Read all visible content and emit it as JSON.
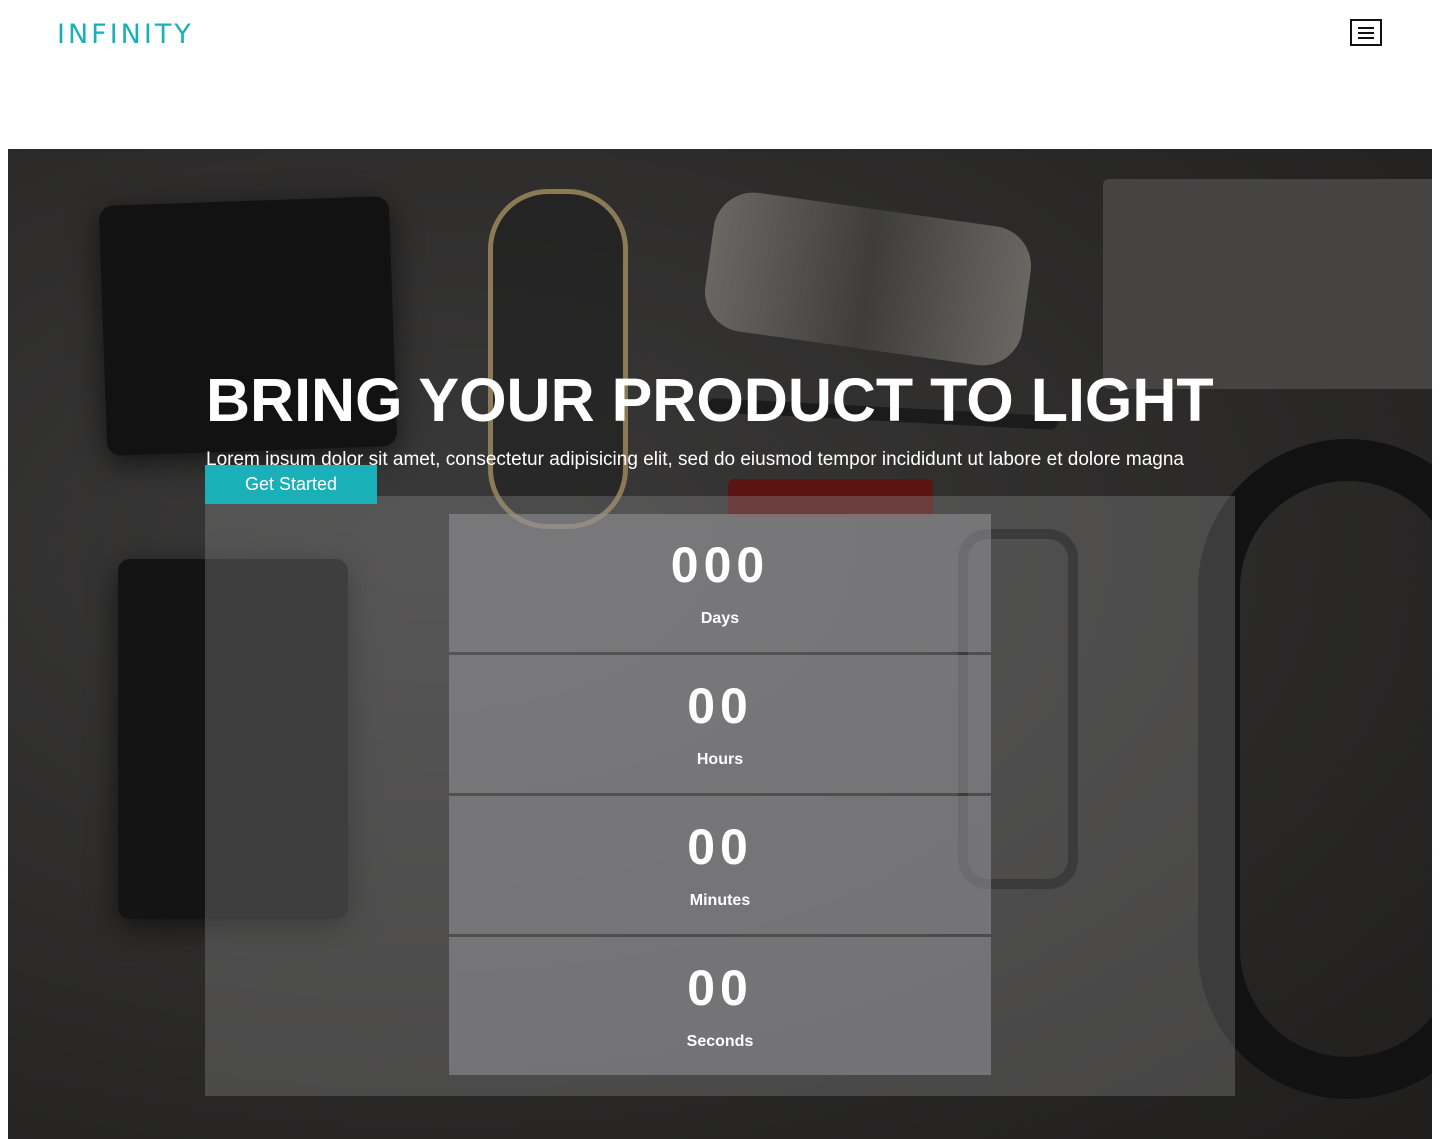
{
  "brand": {
    "logo": "INFINITY",
    "accent_color": "#1ab0b8"
  },
  "header": {
    "menu_icon": "hamburger-menu-icon"
  },
  "hero": {
    "title": "BRING YOUR PRODUCT TO LIGHT",
    "subtitle": "Lorem ipsum dolor sit amet, consectetur adipisicing elit, sed do eiusmod tempor incididunt ut labore et dolore magna",
    "cta_label": "Get Started"
  },
  "countdown": {
    "days": {
      "value": "000",
      "label": "Days"
    },
    "hours": {
      "value": "00",
      "label": "Hours"
    },
    "minutes": {
      "value": "00",
      "label": "Minutes"
    },
    "seconds": {
      "value": "00",
      "label": "Seconds"
    }
  }
}
